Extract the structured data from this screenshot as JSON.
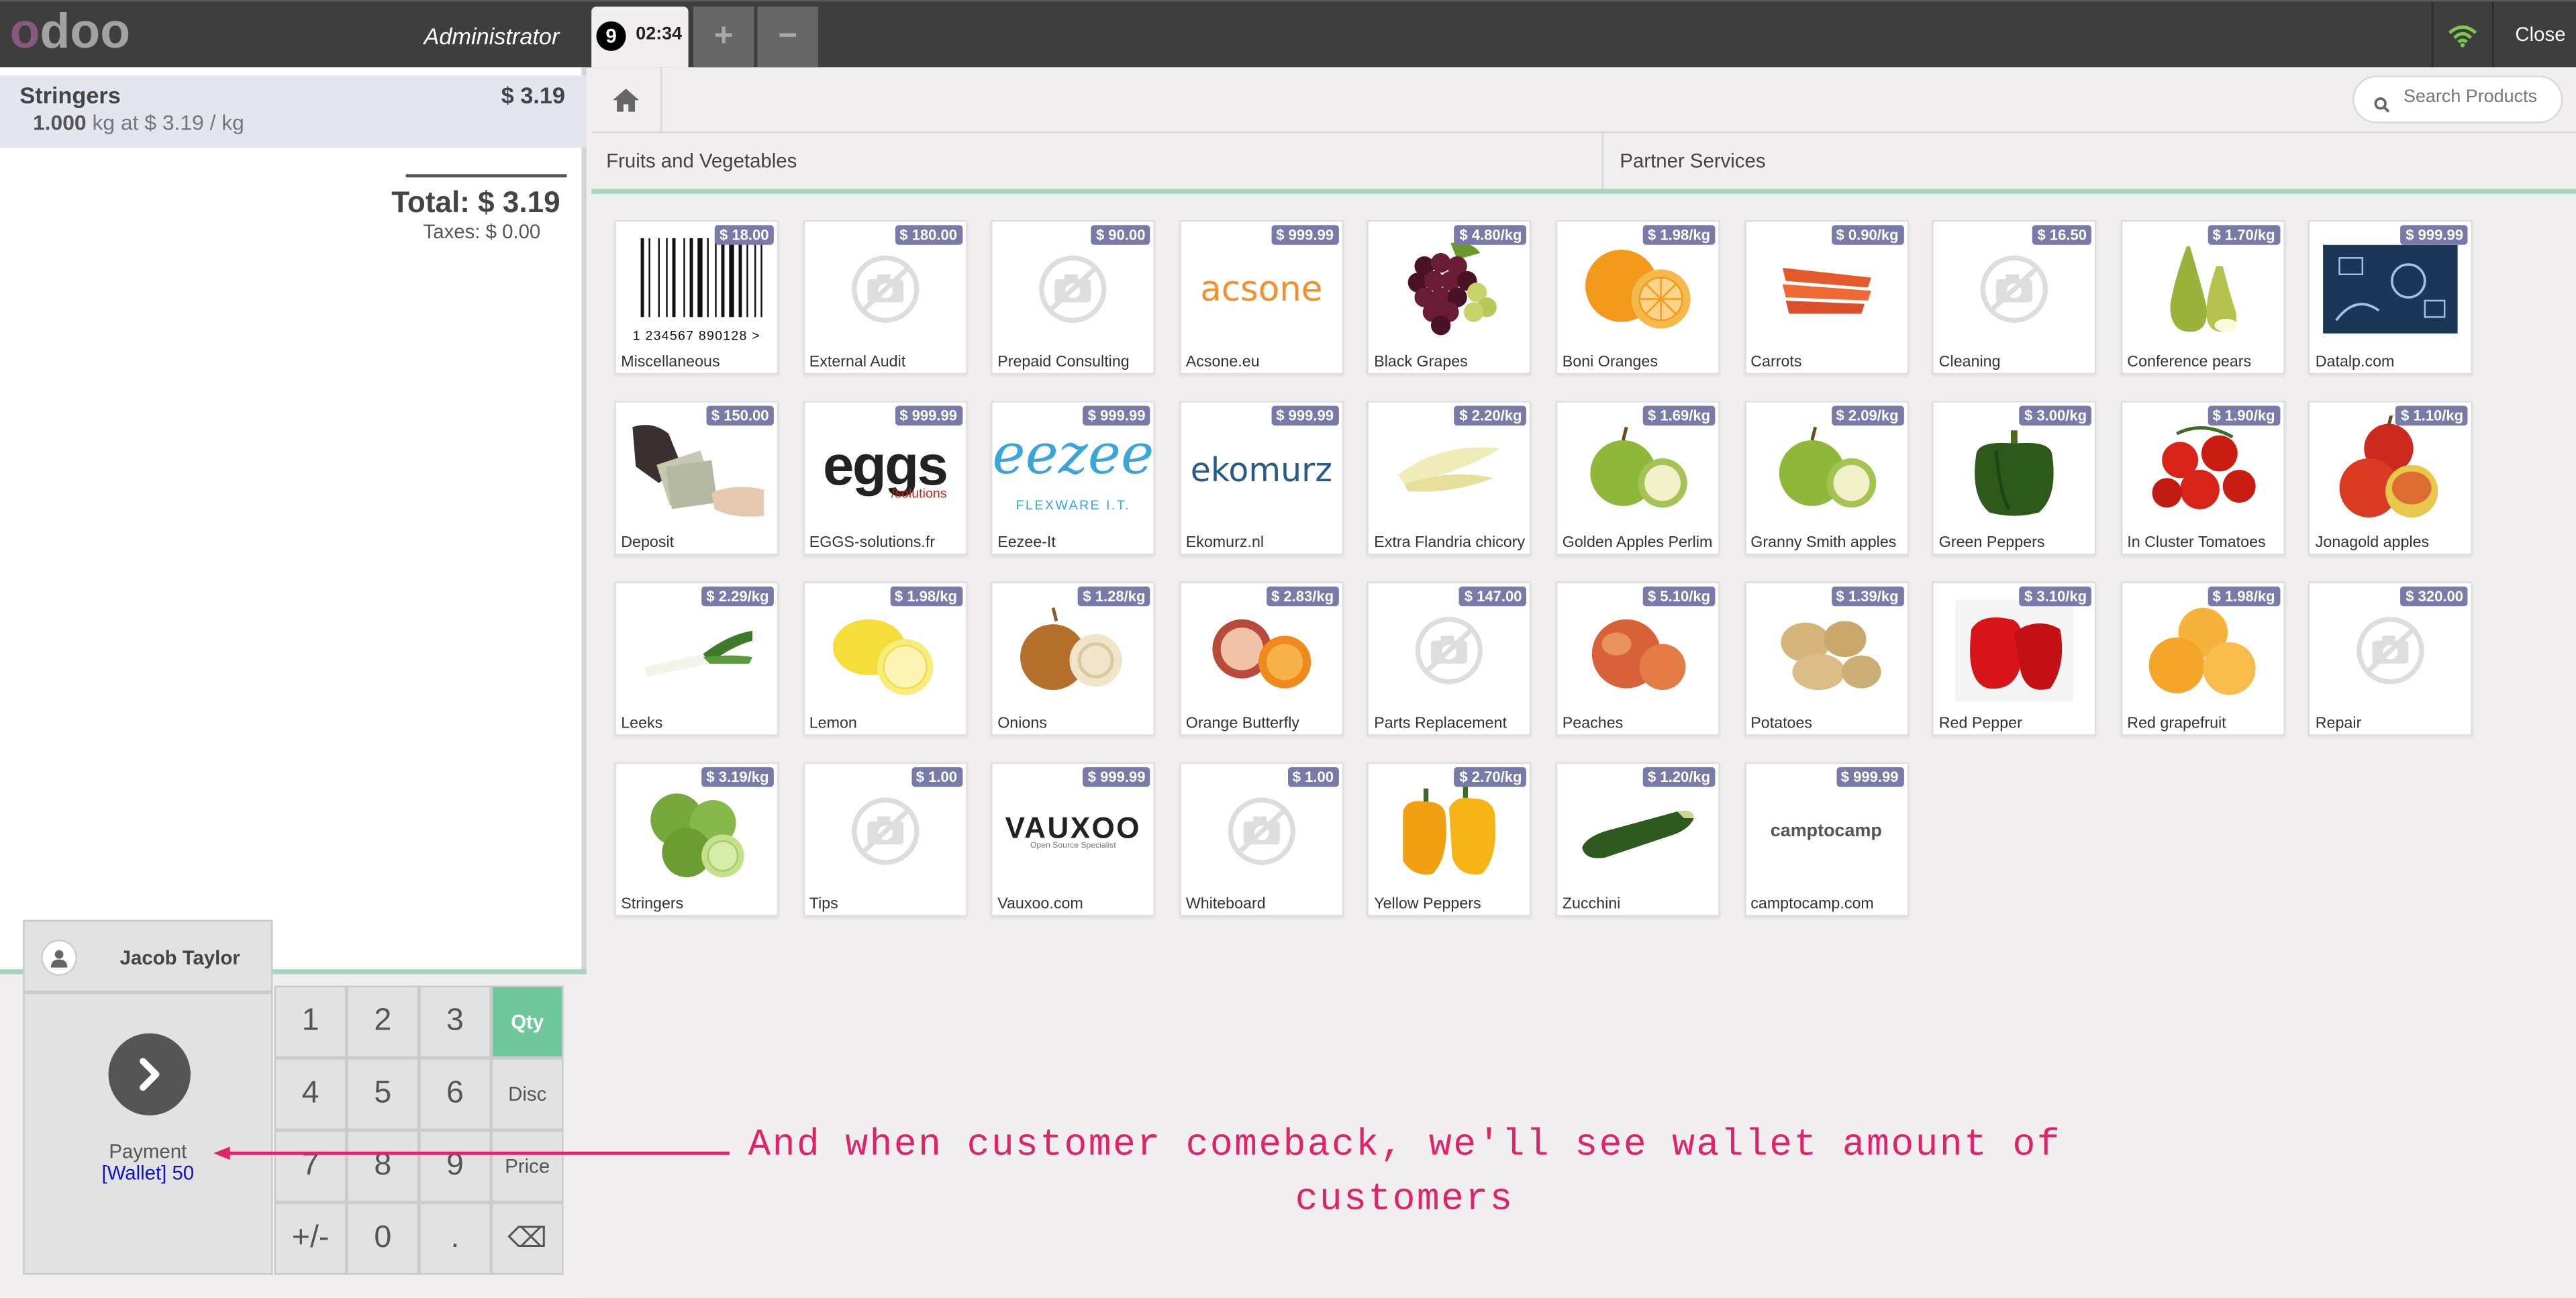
{
  "header": {
    "logo": "odoo",
    "user": "Administrator",
    "order_number": "9",
    "order_time": "02:34",
    "add_order": "+",
    "remove_order": "−",
    "close_label": "Close"
  },
  "order": {
    "line_name": "Stringers",
    "line_price": "$ 3.19",
    "line_qty": "1.000",
    "line_detail": " kg at $ 3.19 / kg",
    "total": "Total: $ 3.19",
    "taxes": "Taxes: $ 0.00"
  },
  "numpad": {
    "customer": "Jacob Taylor",
    "payment_label": "Payment",
    "wallet": "[Wallet] 50",
    "keys": [
      "1",
      "2",
      "3",
      "Qty",
      "4",
      "5",
      "6",
      "Disc",
      "7",
      "8",
      "9",
      "Price",
      "+/-",
      "0",
      ".",
      "⌫"
    ]
  },
  "search": {
    "placeholder": "Search Products"
  },
  "categories": [
    "Fruits and Vegetables",
    "Partner Services"
  ],
  "products": [
    {
      "name": "Miscellaneous",
      "price": "$ 18.00",
      "img": "barcode"
    },
    {
      "name": "External Audit",
      "price": "$ 180.00",
      "img": "placeholder"
    },
    {
      "name": "Prepaid Consulting",
      "price": "$ 90.00",
      "img": "placeholder"
    },
    {
      "name": "Acsone.eu",
      "price": "$ 999.99",
      "img": "logo-acsone",
      "logo": "acsone"
    },
    {
      "name": "Black Grapes",
      "price": "$ 4.80/kg",
      "img": "grapes"
    },
    {
      "name": "Boni Oranges",
      "price": "$ 1.98/kg",
      "img": "orange"
    },
    {
      "name": "Carrots",
      "price": "$ 0.90/kg",
      "img": "carrot"
    },
    {
      "name": "Cleaning",
      "price": "$ 16.50",
      "img": "placeholder"
    },
    {
      "name": "Conference pears",
      "price": "$ 1.70/kg",
      "img": "pear"
    },
    {
      "name": "Datalp.com",
      "price": "$ 999.99",
      "img": "datalp"
    },
    {
      "name": "Deposit",
      "price": "$ 150.00",
      "img": "money"
    },
    {
      "name": "EGGS-solutions.fr",
      "price": "$ 999.99",
      "img": "logo-eggs",
      "logo": "eggs",
      "logo_sub": "/solutions"
    },
    {
      "name": "Eezee-It",
      "price": "$ 999.99",
      "img": "logo-eezee",
      "logo": "eezee",
      "logo_sub": "FLEXWARE I.T."
    },
    {
      "name": "Ekomurz.nl",
      "price": "$ 999.99",
      "img": "logo-ekomurz",
      "logo": "ekomurz"
    },
    {
      "name": "Extra Flandria chicory",
      "price": "$ 2.20/kg",
      "img": "chicory"
    },
    {
      "name": "Golden Apples Perlim",
      "price": "$ 1.69/kg",
      "img": "apple-green"
    },
    {
      "name": "Granny Smith apples",
      "price": "$ 2.09/kg",
      "img": "apple-green"
    },
    {
      "name": "Green Peppers",
      "price": "$ 3.00/kg",
      "img": "pepper-green"
    },
    {
      "name": "In Cluster Tomatoes",
      "price": "$ 1.90/kg",
      "img": "tomato"
    },
    {
      "name": "Jonagold apples",
      "price": "$ 1.10/kg",
      "img": "apple-red"
    },
    {
      "name": "Leeks",
      "price": "$ 2.29/kg",
      "img": "leek"
    },
    {
      "name": "Lemon",
      "price": "$ 1.98/kg",
      "img": "lemon"
    },
    {
      "name": "Onions",
      "price": "$ 1.28/kg",
      "img": "onion"
    },
    {
      "name": "Orange Butterfly",
      "price": "$ 2.83/kg",
      "img": "butterfly"
    },
    {
      "name": "Parts Replacement",
      "price": "$ 147.00",
      "img": "placeholder"
    },
    {
      "name": "Peaches",
      "price": "$ 5.10/kg",
      "img": "peach"
    },
    {
      "name": "Potatoes",
      "price": "$ 1.39/kg",
      "img": "potato"
    },
    {
      "name": "Red Pepper",
      "price": "$ 3.10/kg",
      "img": "pepper-red"
    },
    {
      "name": "Red grapefruit",
      "price": "$ 1.98/kg",
      "img": "grapefruit"
    },
    {
      "name": "Repair",
      "price": "$ 320.00",
      "img": "placeholder"
    },
    {
      "name": "Stringers",
      "price": "$ 3.19/kg",
      "img": "lime"
    },
    {
      "name": "Tips",
      "price": "$ 1.00",
      "img": "placeholder"
    },
    {
      "name": "Vauxoo.com",
      "price": "$ 999.99",
      "img": "logo-vauxoo",
      "logo": "VAUXOO",
      "logo_sub": "Open Source Specialist"
    },
    {
      "name": "Whiteboard",
      "price": "$ 1.00",
      "img": "placeholder"
    },
    {
      "name": "Yellow Peppers",
      "price": "$ 2.70/kg",
      "img": "pepper-yellow"
    },
    {
      "name": "Zucchini",
      "price": "$ 1.20/kg",
      "img": "zucchini"
    },
    {
      "name": "camptocamp.com",
      "price": "$ 999.99",
      "img": "logo-camptocamp",
      "logo": "camptocamp"
    }
  ],
  "barcode_digits": "1 234567 890128 >",
  "annotation": "And when customer comeback, we'll see wallet amount of customers",
  "colors": {
    "accent": "#6ec89b",
    "brand_purple": "#875a7b",
    "price_tag": "#7a7aa8",
    "annotation": "#e0226b",
    "wallet_text": "#1010d0"
  }
}
